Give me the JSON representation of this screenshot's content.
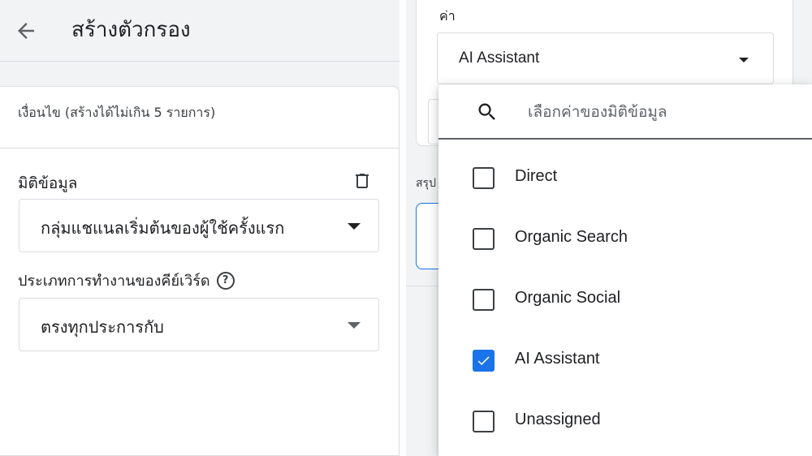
{
  "header": {
    "title": "สร้างตัวกรอง"
  },
  "conditions": {
    "label": "เงื่อนไข (สร้างได้ไม่เกิน 5 รายการ)"
  },
  "dimension": {
    "label": "มิติข้อมูล",
    "value": "กลุ่มแชแนลเริ่มต้นของผู้ใช้ครั้งแรก"
  },
  "match_type": {
    "label": "ประเภทการทำงานของคีย์เวิร์ด",
    "value": "ตรงทุกประการกับ"
  },
  "value_field": {
    "label": "ค่า",
    "value": "AI Assistant"
  },
  "summary": {
    "label": "สรุป"
  },
  "dropdown": {
    "search_placeholder": "เลือกค่าของมิติข้อมูล",
    "options": [
      {
        "label": "Direct",
        "checked": false
      },
      {
        "label": "Organic Search",
        "checked": false
      },
      {
        "label": "Organic Social",
        "checked": false
      },
      {
        "label": "AI Assistant",
        "checked": true
      },
      {
        "label": "Unassigned",
        "checked": false
      }
    ]
  },
  "colors": {
    "accent": "#1a73e8",
    "panel_bg": "#f1f3f4",
    "border": "#dadce0"
  },
  "icons": {
    "back": "arrow-left-icon",
    "delete": "trash-icon",
    "help": "help-circle-icon",
    "search": "search-icon",
    "dropdown": "caret-down-icon",
    "check": "check-icon"
  }
}
